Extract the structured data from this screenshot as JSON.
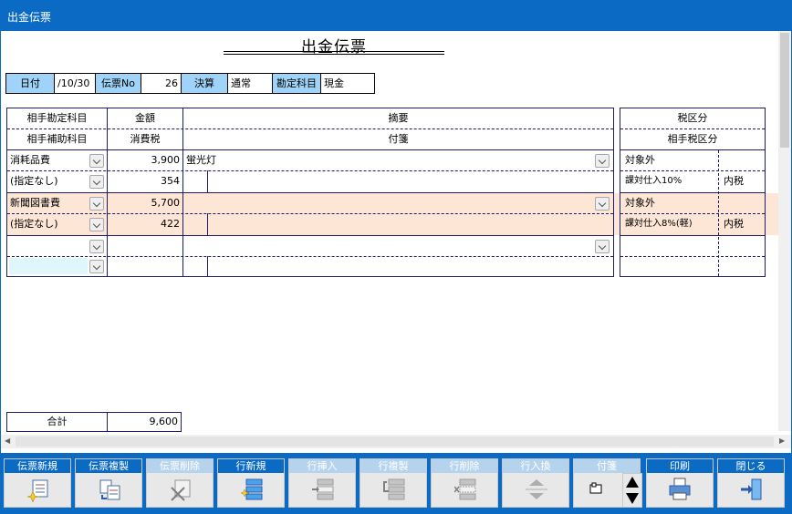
{
  "window": {
    "title": "出金伝票"
  },
  "document": {
    "title": "出金伝票"
  },
  "header": {
    "date_label": "日付",
    "date_value": "/10/30",
    "slip_no_label": "伝票No",
    "slip_no_value": "26",
    "settlement_label": "決算",
    "settlement_value": "通常",
    "account_label": "勘定科目",
    "account_value": "現金"
  },
  "columns": {
    "counter_account": "相手勘定科目",
    "counter_sub_account": "相手補助科目",
    "amount": "金額",
    "tax": "消費税",
    "description": "摘要",
    "note": "付箋",
    "tax_category": "税区分",
    "counter_tax_category": "相手税区分"
  },
  "rows": [
    {
      "account": "消耗品費",
      "sub_account": "(指定なし)",
      "amount": "3,900",
      "tax": "354",
      "description": "蛍光灯",
      "note": "",
      "tax_cat": "対象外",
      "counter_tax_cat": "課対仕入10%",
      "tax_type": "内税"
    },
    {
      "account": "新聞図書費",
      "sub_account": "(指定なし)",
      "amount": "5,700",
      "tax": "422",
      "description": "",
      "note": "",
      "tax_cat": "対象外",
      "counter_tax_cat": "課対仕入8%(軽)",
      "tax_type": "内税"
    },
    {
      "account": "",
      "sub_account": "",
      "amount": "",
      "tax": "",
      "description": "",
      "note": "",
      "tax_cat": "",
      "counter_tax_cat": "",
      "tax_type": ""
    }
  ],
  "total": {
    "label": "合計",
    "value": "9,600"
  },
  "toolbar": {
    "new_slip": "伝票新規",
    "copy_slip": "伝票複製",
    "delete_slip": "伝票削除",
    "new_row": "行新規",
    "insert_row": "行挿入",
    "copy_row": "行複製",
    "delete_row": "行削除",
    "swap_row": "行入換",
    "note": "付箋",
    "print": "印刷",
    "close": "閉じる"
  },
  "colors": {
    "accent": "#0b6bc4",
    "label_bg": "#9fd3f7",
    "highlight_row": "#fde6d6",
    "grid_line": "#1c1c6e"
  }
}
